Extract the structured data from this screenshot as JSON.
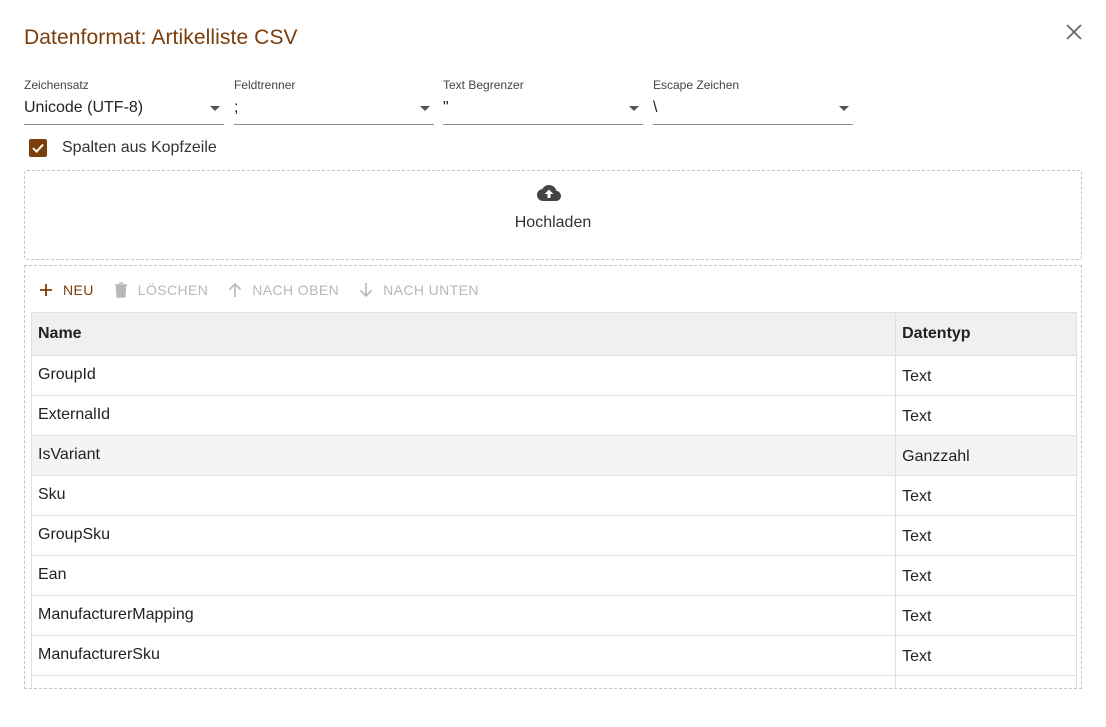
{
  "dialog": {
    "title": "Datenformat: Artikelliste CSV",
    "close_icon": "close-icon"
  },
  "fields": [
    {
      "label": "Zeichensatz",
      "value": "Unicode (UTF-8)"
    },
    {
      "label": "Feldtrenner",
      "value": ";"
    },
    {
      "label": "Text Begrenzer",
      "value": "\""
    },
    {
      "label": "Escape Zeichen",
      "value": "\\"
    }
  ],
  "header_checkbox": {
    "label": "Spalten aus Kopfzeile",
    "checked": true
  },
  "upload": {
    "label": "Hochladen",
    "icon": "cloud-upload-icon"
  },
  "toolbar": {
    "new_label": "NEU",
    "delete_label": "LÖSCHEN",
    "up_label": "NACH OBEN",
    "down_label": "NACH UNTEN"
  },
  "table": {
    "columns": [
      "Name",
      "Datentyp"
    ],
    "rows": [
      {
        "name": "GroupId",
        "type": "Text"
      },
      {
        "name": "ExternalId",
        "type": "Text"
      },
      {
        "name": "IsVariant",
        "type": "Ganzzahl"
      },
      {
        "name": "Sku",
        "type": "Text"
      },
      {
        "name": "GroupSku",
        "type": "Text"
      },
      {
        "name": "Ean",
        "type": "Text"
      },
      {
        "name": "ManufacturerMapping",
        "type": "Text"
      },
      {
        "name": "ManufacturerSku",
        "type": "Text"
      },
      {
        "name": "",
        "type": ""
      }
    ]
  },
  "colors": {
    "accent": "#7a3e0c",
    "disabled": "#b8b8b8"
  }
}
